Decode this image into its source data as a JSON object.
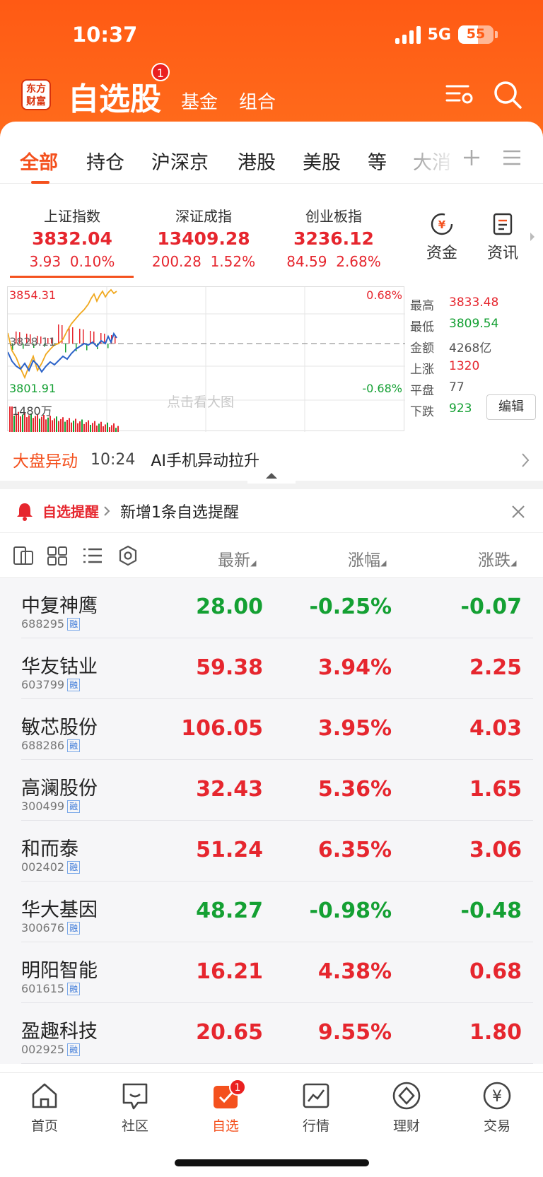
{
  "status_bar": {
    "time": "10:37",
    "network": "5G",
    "battery": "55"
  },
  "header": {
    "logo_text": "东方财富",
    "title": "自选股",
    "title_badge": "1",
    "tabs": [
      "基金",
      "组合"
    ]
  },
  "category_tabs": [
    "全部",
    "持仓",
    "沪深京",
    "港股",
    "美股",
    "等",
    "大消"
  ],
  "active_tab": "全部",
  "indices": [
    {
      "name": "上证指数",
      "value": "3832.04",
      "change": "3.93",
      "pct": "0.10%",
      "trend": "up"
    },
    {
      "name": "深证成指",
      "value": "13409.28",
      "change": "200.28",
      "pct": "1.52%",
      "trend": "up"
    },
    {
      "name": "创业板指",
      "value": "3236.12",
      "change": "84.59",
      "pct": "2.68%",
      "trend": "up"
    }
  ],
  "quick_buttons": [
    {
      "label": "资金",
      "icon": "yuan-circle-icon"
    },
    {
      "label": "资讯",
      "icon": "news-icon"
    }
  ],
  "mini_chart": {
    "high_label": "3854.31",
    "mid_label": "3828.11",
    "low_label": "3801.91",
    "pct_high": "0.68%",
    "pct_low": "-0.68%",
    "volume_label": "1480万",
    "watermark": "点击看大图"
  },
  "market_stats": [
    {
      "label": "最高",
      "value": "3833.48",
      "color": "red"
    },
    {
      "label": "最低",
      "value": "3809.54",
      "color": "green"
    },
    {
      "label": "金额",
      "value": "4268亿",
      "color": "gray"
    },
    {
      "label": "上涨",
      "value": "1320",
      "color": "red"
    },
    {
      "label": "平盘",
      "value": "77",
      "color": "gray"
    },
    {
      "label": "下跌",
      "value": "923",
      "color": "green"
    }
  ],
  "edit_label": "编辑",
  "market_news": {
    "tag": "大盘异动",
    "time": "10:24",
    "text": "AI手机异动拉升"
  },
  "alert": {
    "title": "自选提醒",
    "text": "新增1条自选提醒"
  },
  "table_headers": {
    "latest": "最新",
    "change_pct": "涨幅",
    "change": "涨跌"
  },
  "stocks": [
    {
      "name": "中复神鹰",
      "code": "688295",
      "tag": "融",
      "price": "28.00",
      "pct": "-0.25%",
      "chg": "-0.07",
      "trend": "down"
    },
    {
      "name": "华友钴业",
      "code": "603799",
      "tag": "融",
      "price": "59.38",
      "pct": "3.94%",
      "chg": "2.25",
      "trend": "up"
    },
    {
      "name": "敏芯股份",
      "code": "688286",
      "tag": "融",
      "price": "106.05",
      "pct": "3.95%",
      "chg": "4.03",
      "trend": "up"
    },
    {
      "name": "高澜股份",
      "code": "300499",
      "tag": "融",
      "price": "32.43",
      "pct": "5.36%",
      "chg": "1.65",
      "trend": "up"
    },
    {
      "name": "和而泰",
      "code": "002402",
      "tag": "融",
      "price": "51.24",
      "pct": "6.35%",
      "chg": "3.06",
      "trend": "up"
    },
    {
      "name": "华大基因",
      "code": "300676",
      "tag": "融",
      "price": "48.27",
      "pct": "-0.98%",
      "chg": "-0.48",
      "trend": "down"
    },
    {
      "name": "明阳智能",
      "code": "601615",
      "tag": "融",
      "price": "16.21",
      "pct": "4.38%",
      "chg": "0.68",
      "trend": "up"
    },
    {
      "name": "盈趣科技",
      "code": "002925",
      "tag": "融",
      "price": "20.65",
      "pct": "9.55%",
      "chg": "1.80",
      "trend": "up"
    }
  ],
  "bottom_nav": [
    {
      "label": "首页",
      "icon": "home-icon"
    },
    {
      "label": "社区",
      "icon": "chat-icon"
    },
    {
      "label": "自选",
      "icon": "watchlist-icon",
      "badge": "1",
      "active": true
    },
    {
      "label": "行情",
      "icon": "chart-icon"
    },
    {
      "label": "理财",
      "icon": "diamond-icon"
    },
    {
      "label": "交易",
      "icon": "yen-circle-icon"
    }
  ],
  "colors": {
    "brand": "#ff5a14",
    "up": "#e6262e",
    "down": "#14a033"
  }
}
